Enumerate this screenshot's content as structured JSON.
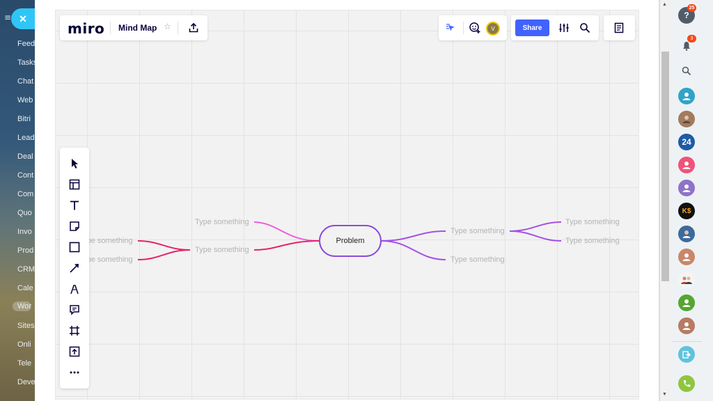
{
  "bitrix_sidebar": {
    "items": [
      {
        "label": "Feed"
      },
      {
        "label": "Tasks"
      },
      {
        "label": "Chat"
      },
      {
        "label": "Web"
      },
      {
        "label": "Bitri"
      },
      {
        "label": "Lead"
      },
      {
        "label": "Deal"
      },
      {
        "label": "Cont"
      },
      {
        "label": "Com"
      },
      {
        "label": "Quo"
      },
      {
        "label": "Invo"
      },
      {
        "label": "Prod"
      },
      {
        "label": "CRM"
      },
      {
        "label": "Cale"
      },
      {
        "label": "Wor"
      },
      {
        "label": "Sites"
      },
      {
        "label": "Onli"
      },
      {
        "label": "Tele"
      },
      {
        "label": "Deve"
      }
    ]
  },
  "board_header": {
    "logo": "miro",
    "board_name": "Mind Map",
    "star": "☆"
  },
  "collab_bar": {
    "avatar_initial": "V"
  },
  "share_bar": {
    "share_label": "Share"
  },
  "mindmap": {
    "root": "Problem",
    "left_level1": [
      "Type something",
      "Type something"
    ],
    "left_level2": [
      "Type something",
      "Type something"
    ],
    "right_level1": [
      "Type something",
      "Type something"
    ],
    "right_level2": [
      "Type something",
      "Type something"
    ]
  },
  "right_panel": {
    "help_badge": "25",
    "notifications_badge": "3",
    "avatar_24": "24",
    "avatar_k": "K$"
  },
  "colors": {
    "left_branch_light": "#ee5fd9",
    "left_branch_dark": "#e8216a",
    "right_branch": "#a64fe6",
    "root_border": "#8a4bdb",
    "share_button": "#4262ff"
  }
}
